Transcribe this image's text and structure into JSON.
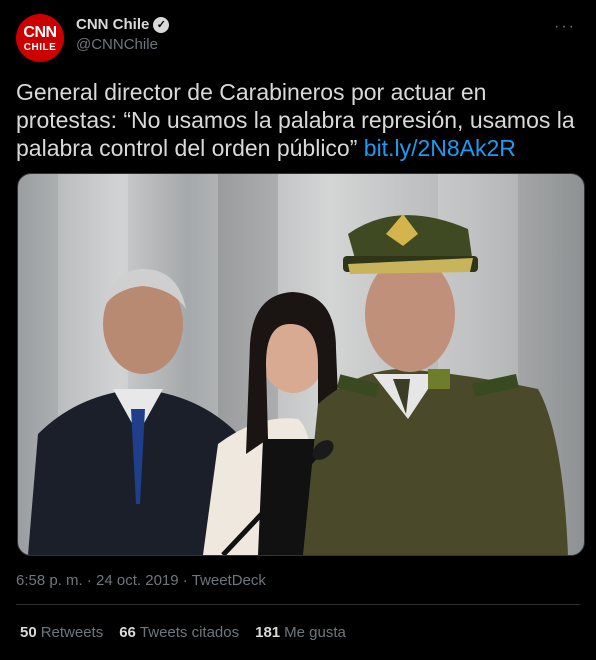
{
  "author": {
    "avatar_line1": "CNN",
    "avatar_line2": "CHILE",
    "display_name": "CNN Chile",
    "verified_icon": "verified-badge-icon",
    "handle": "@CNNChile"
  },
  "tweet": {
    "text": "General director de Carabineros por actuar en protestas: “No usamos la palabra represión, usamos la palabra control del orden público”",
    "link": "bit.ly/2N8Ak2R"
  },
  "meta": {
    "time": "6:58 p. m.",
    "separator1": "·",
    "date": "24 oct. 2019",
    "separator2": "·",
    "source": "TweetDeck"
  },
  "stats": {
    "retweets_count": "50",
    "retweets_label": "Retweets",
    "quotes_count": "66",
    "quotes_label": "Tweets citados",
    "likes_count": "181",
    "likes_label": "Me gusta"
  },
  "colors": {
    "background": "#000000",
    "text": "#d9d9d9",
    "secondary": "#6e767d",
    "link": "#1d9bf0",
    "brand_red": "#cc0000"
  }
}
